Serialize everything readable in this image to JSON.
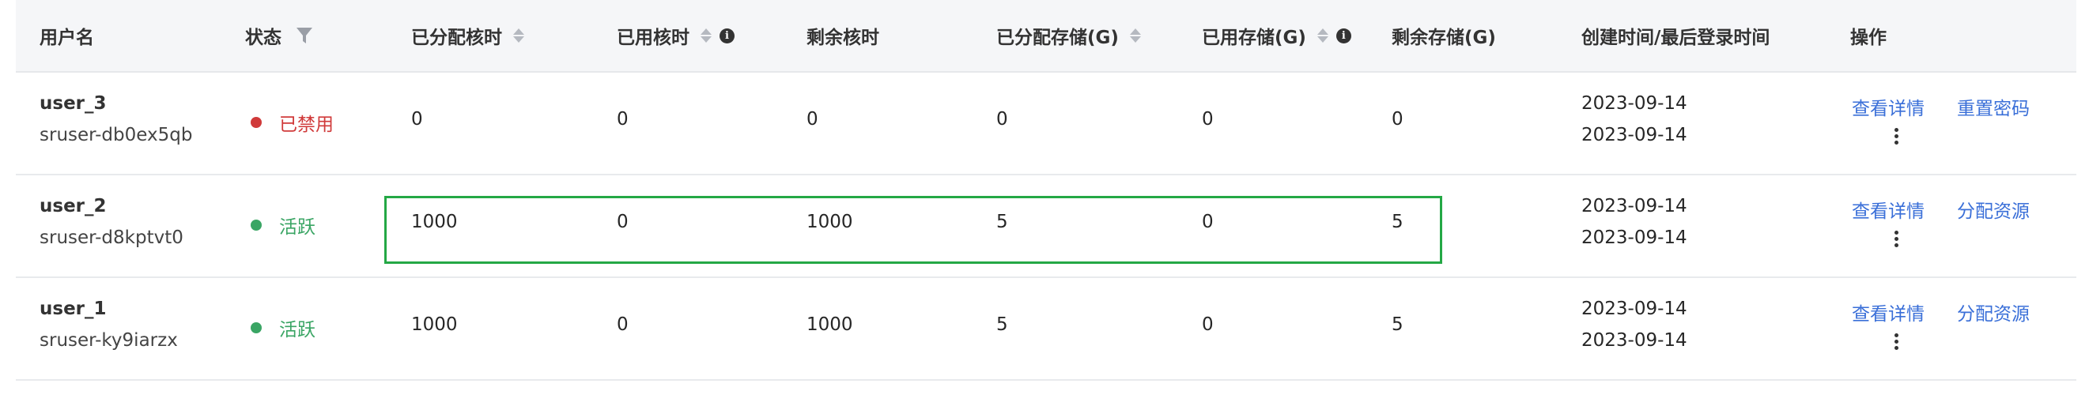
{
  "columns": {
    "username": "用户名",
    "status": "状态",
    "allocated_core_hours": "已分配核时",
    "used_core_hours": "已用核时",
    "remaining_core_hours": "剩余核时",
    "allocated_storage": "已分配存储(G)",
    "used_storage": "已用存储(G)",
    "remaining_storage": "剩余存储(G)",
    "created_last_login": "创建时间/最后登录时间",
    "actions": "操作"
  },
  "colors": {
    "disabled": "#d03a3a",
    "active": "#3aa564",
    "link": "#3a6fd8",
    "highlight": "#24a845"
  },
  "rows": [
    {
      "name": "user_3",
      "id": "sruser-db0ex5qb",
      "status": "已禁用",
      "status_type": "disabled",
      "allocated_core_hours": "0",
      "used_core_hours": "0",
      "remaining_core_hours": "0",
      "allocated_storage": "0",
      "used_storage": "0",
      "remaining_storage": "0",
      "created": "2023-09-14",
      "last_login": "2023-09-14",
      "action_1": "查看详情",
      "action_2": "重置密码"
    },
    {
      "name": "user_2",
      "id": "sruser-d8kptvt0",
      "status": "活跃",
      "status_type": "active",
      "allocated_core_hours": "1000",
      "used_core_hours": "0",
      "remaining_core_hours": "1000",
      "allocated_storage": "5",
      "used_storage": "0",
      "remaining_storage": "5",
      "created": "2023-09-14",
      "last_login": "2023-09-14",
      "action_1": "查看详情",
      "action_2": "分配资源"
    },
    {
      "name": "user_1",
      "id": "sruser-ky9iarzx",
      "status": "活跃",
      "status_type": "active",
      "allocated_core_hours": "1000",
      "used_core_hours": "0",
      "remaining_core_hours": "1000",
      "allocated_storage": "5",
      "used_storage": "0",
      "remaining_storage": "5",
      "created": "2023-09-14",
      "last_login": "2023-09-14",
      "action_1": "查看详情",
      "action_2": "分配资源"
    }
  ],
  "icons": {
    "sort": "sort-icon",
    "info": "info-icon",
    "filter": "filter-icon",
    "more": "more-vertical-icon"
  }
}
